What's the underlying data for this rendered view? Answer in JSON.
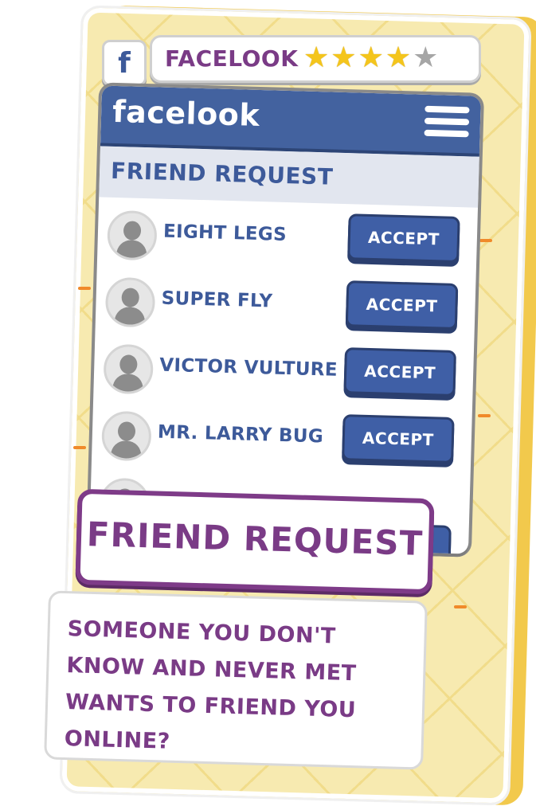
{
  "app": {
    "badge_letter": "f",
    "name": "FACELOOK",
    "rating": 4,
    "rating_max": 5
  },
  "phone": {
    "brand": "facelook",
    "section_title": "FRIEND REQUEST",
    "requests": [
      {
        "name": "EIGHT LEGS",
        "action": "ACCEPT"
      },
      {
        "name": "SUPER FLY",
        "action": "ACCEPT"
      },
      {
        "name": "VICTOR VULTURE",
        "action": "ACCEPT"
      },
      {
        "name": "MR. LARRY BUG",
        "action": "ACCEPT"
      }
    ]
  },
  "banner": {
    "title": "FRIEND REQUEST"
  },
  "question": {
    "text": "SOMEONE YOU DON'T KNOW AND NEVER MET WANTS TO FRIEND YOU ONLINE?"
  },
  "colors": {
    "card_bg": "#f7eab0",
    "accent_purple": "#7a3b86",
    "facebook_blue": "#43629f",
    "button_blue": "#3f5fa6",
    "star_gold": "#f4c51c"
  }
}
